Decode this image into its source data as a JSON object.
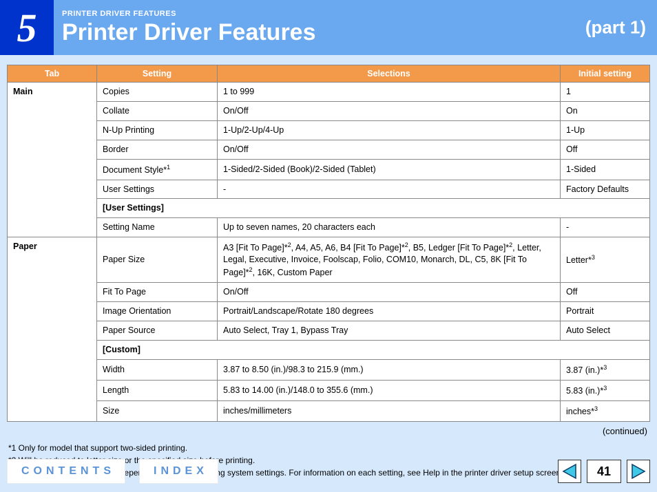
{
  "header": {
    "chapter_num": "5",
    "eyebrow": "PRINTER DRIVER FEATURES",
    "title": "Printer Driver Features",
    "part": "(part 1)"
  },
  "columns": {
    "tab": "Tab",
    "setting": "Setting",
    "selections": "Selections",
    "initial": "Initial setting"
  },
  "rows": {
    "main_label": "Main",
    "paper_label": "Paper",
    "copies": {
      "setting": "Copies",
      "sel": "1 to 999",
      "init": "1"
    },
    "collate": {
      "setting": "Collate",
      "sel": "On/Off",
      "init": "On"
    },
    "nup": {
      "setting": "N-Up Printing",
      "sel": "1-Up/2-Up/4-Up",
      "init": "1-Up"
    },
    "border": {
      "setting": "Border",
      "sel": "On/Off",
      "init": "Off"
    },
    "doc_style": {
      "setting": "Document Style*",
      "setting_sup": "1",
      "sel": "1-Sided/2-Sided (Book)/2-Sided (Tablet)",
      "init": "1-Sided"
    },
    "user_settings": {
      "setting": "User Settings",
      "sel": "-",
      "init": "Factory Defaults"
    },
    "user_header": "[User Settings]",
    "setting_name": {
      "setting": "Setting Name",
      "sel": "Up to seven names, 20 characters each",
      "init": "-"
    },
    "paper_size": {
      "setting": "Paper Size",
      "sel_a": "A3 [Fit To Page]*",
      "sel_b": ", A4, A5, A6, B4 [Fit To Page]*",
      "sel_c": ", B5, Ledger [Fit To Page]*",
      "sel_d": ", Letter, Legal, Executive, Invoice, Foolscap, Folio, COM10, Monarch, DL, C5, 8K [Fit To Page]*",
      "sel_e": ", 16K, Custom Paper",
      "sup2": "2",
      "init": "Letter*",
      "init_sup": "3"
    },
    "fit_to_page": {
      "setting": "Fit To Page",
      "sel": "On/Off",
      "init": "Off"
    },
    "image_orient": {
      "setting": "Image Orientation",
      "sel": "Portrait/Landscape/Rotate 180 degrees",
      "init": "Portrait"
    },
    "paper_source": {
      "setting": "Paper Source",
      "sel": "Auto Select, Tray 1, Bypass Tray",
      "init": "Auto Select"
    },
    "custom_header": "[Custom]",
    "width": {
      "setting": "Width",
      "sel": "3.87 to 8.50 (in.)/98.3 to 215.9 (mm.)",
      "init": "3.87 (in.)*",
      "init_sup": "3"
    },
    "length": {
      "setting": "Length",
      "sel": "5.83 to 14.00 (in.)/148.0 to 355.6 (mm.)",
      "init": "5.83 (in.)*",
      "init_sup": "3"
    },
    "size": {
      "setting": "Size",
      "sel": "inches/millimeters",
      "init": "inches*",
      "init_sup": "3"
    }
  },
  "continued": "(continued)",
  "footnotes": {
    "f1": "*1 Only for model that support two-sided printing.",
    "f2": "*2 Will be reduced to letter size or the specified size before printing.",
    "f3": "*3 This initial setting may vary depending on your operating system settings. For information on each setting, see Help in the printer driver setup screen."
  },
  "footer": {
    "contents": "CONTENTS",
    "index": "INDEX",
    "page": "41"
  }
}
